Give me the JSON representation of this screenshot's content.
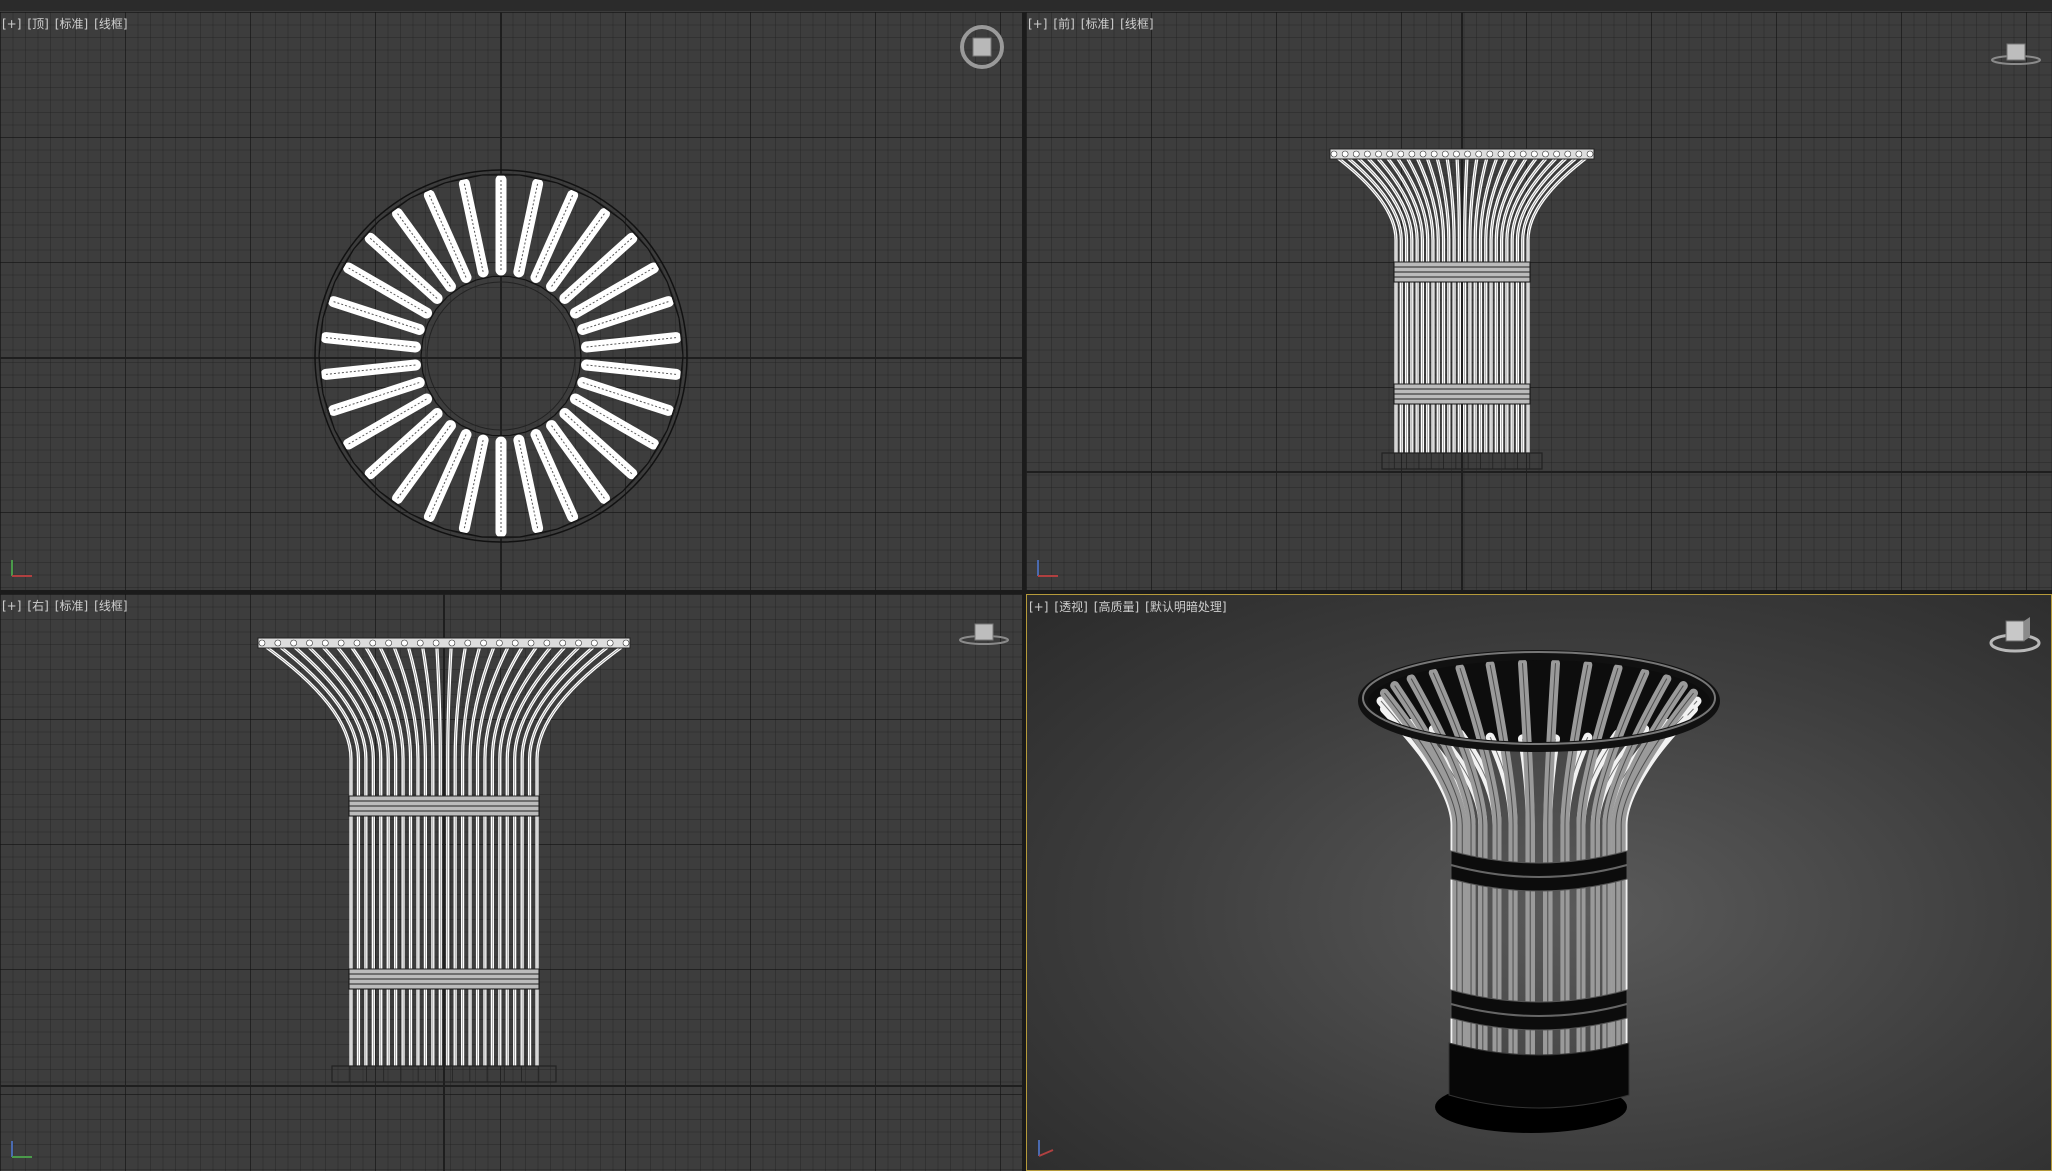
{
  "viewports": {
    "top": {
      "labels": [
        "[+]",
        "[顶]",
        "[标准]",
        "[线框]"
      ]
    },
    "front": {
      "labels": [
        "[+]",
        "[前]",
        "[标准]",
        "[线框]"
      ]
    },
    "right": {
      "labels": [
        "[+]",
        "[右]",
        "[标准]",
        "[线框]"
      ]
    },
    "perspective": {
      "labels": [
        "[+]",
        "[透视]",
        "[高质量]",
        "[默认明暗处理]"
      ],
      "active": true
    }
  },
  "colors": {
    "viewport_bg": "#3d3d3d",
    "grid_line": "#2a2a2a",
    "active_border": "#b59a3a",
    "wireframe": "#ffffff"
  },
  "icons": [
    "viewcube-icon",
    "axis-tripod-icon"
  ]
}
